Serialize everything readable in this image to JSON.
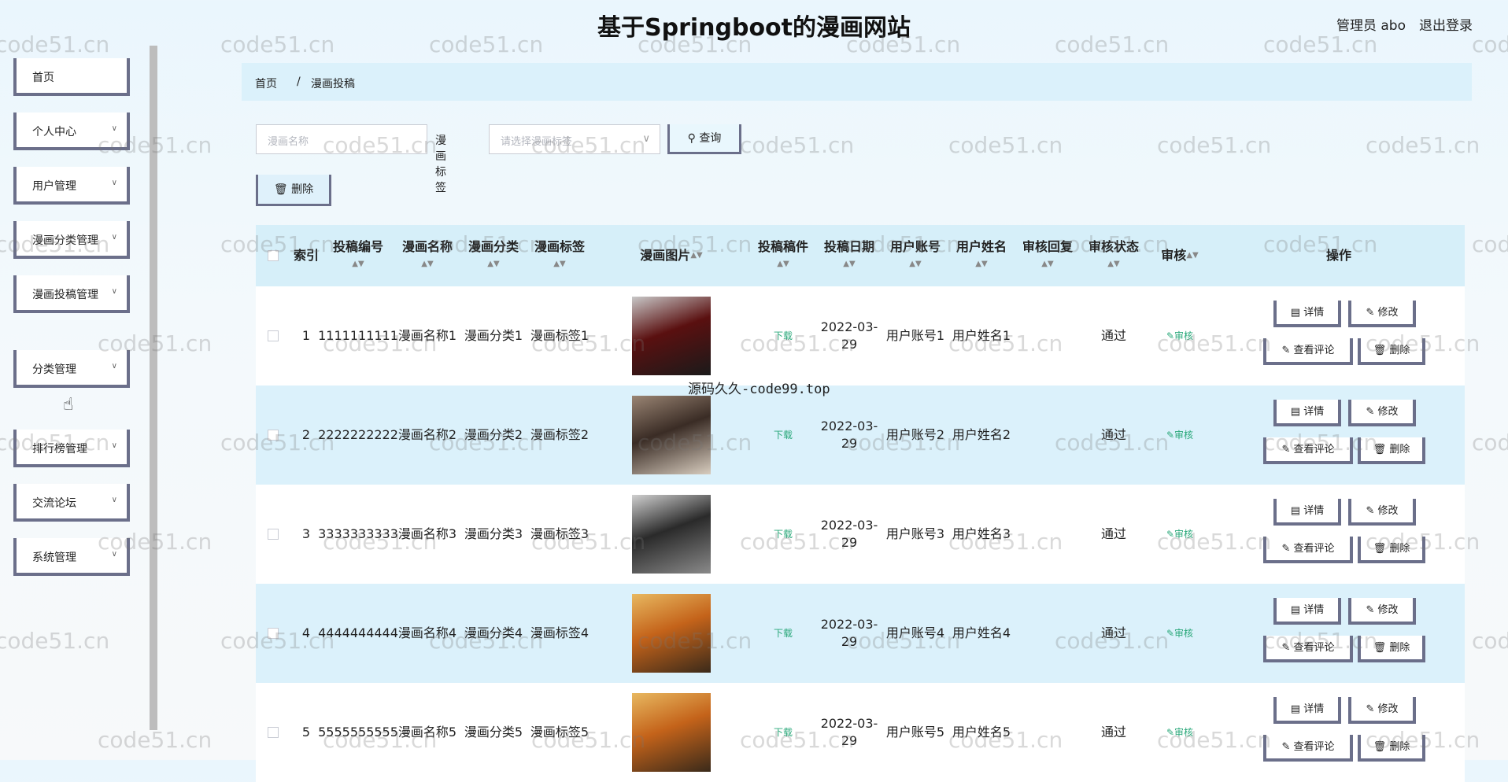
{
  "header": {
    "title": "基于Springboot的漫画网站",
    "user": "管理员 abo",
    "logout": "退出登录"
  },
  "sidebar": {
    "items": [
      {
        "label": "首页",
        "has_chevron": false
      },
      {
        "label": "个人中心",
        "has_chevron": true
      },
      {
        "label": "用户管理",
        "has_chevron": true
      },
      {
        "label": "漫画分类管理",
        "has_chevron": true
      },
      {
        "label": "漫画投稿管理",
        "has_chevron": true
      },
      {
        "label": "分类管理",
        "has_chevron": true
      },
      {
        "label": "排行榜管理",
        "has_chevron": true
      },
      {
        "label": "交流论坛",
        "has_chevron": true
      },
      {
        "label": "系统管理",
        "has_chevron": true
      }
    ]
  },
  "breadcrumb": {
    "home": "首页",
    "sep": "/",
    "current": "漫画投稿"
  },
  "search": {
    "name_placeholder": "漫画名称",
    "tag_label": "漫画标签",
    "tag_placeholder": "请选择漫画标签",
    "query_label": "查询"
  },
  "toolbar": {
    "delete_label": "删除"
  },
  "table": {
    "headers": [
      "索引",
      "投稿编号",
      "漫画名称",
      "漫画分类",
      "漫画标签",
      "漫画图片",
      "投稿稿件",
      "投稿日期",
      "用户账号",
      "用户姓名",
      "审核回复",
      "审核状态",
      "审核",
      "操作"
    ],
    "rows": [
      {
        "index": "1",
        "code": "1111111111",
        "name": "漫画名称1",
        "category": "漫画分类1",
        "tag": "漫画标签1",
        "file": "下载",
        "date": "2022-03-29",
        "account": "用户账号1",
        "username": "用户姓名1",
        "reply": "",
        "status": "通过",
        "audit": "审核"
      },
      {
        "index": "2",
        "code": "2222222222",
        "name": "漫画名称2",
        "category": "漫画分类2",
        "tag": "漫画标签2",
        "file": "下载",
        "date": "2022-03-29",
        "account": "用户账号2",
        "username": "用户姓名2",
        "reply": "",
        "status": "通过",
        "audit": "审核"
      },
      {
        "index": "3",
        "code": "3333333333",
        "name": "漫画名称3",
        "category": "漫画分类3",
        "tag": "漫画标签3",
        "file": "下载",
        "date": "2022-03-29",
        "account": "用户账号3",
        "username": "用户姓名3",
        "reply": "",
        "status": "通过",
        "audit": "审核"
      },
      {
        "index": "4",
        "code": "4444444444",
        "name": "漫画名称4",
        "category": "漫画分类4",
        "tag": "漫画标签4",
        "file": "下载",
        "date": "2022-03-29",
        "account": "用户账号4",
        "username": "用户姓名4",
        "reply": "",
        "status": "通过",
        "audit": "审核"
      },
      {
        "index": "5",
        "code": "5555555555",
        "name": "漫画名称5",
        "category": "漫画分类5",
        "tag": "漫画标签5",
        "file": "下载",
        "date": "2022-03-29",
        "account": "用户账号5",
        "username": "用户姓名5",
        "reply": "",
        "status": "通过",
        "audit": "审核"
      }
    ],
    "actions": {
      "detail": "详情",
      "edit": "修改",
      "comments": "查看评论",
      "delete": "删除"
    }
  },
  "watermark": "code51.cn",
  "promo": "源码久久-code99.top",
  "colors": {
    "accent": "#dbf1fb",
    "button_border": "#6b6f8a",
    "link": "#2aa87a"
  }
}
